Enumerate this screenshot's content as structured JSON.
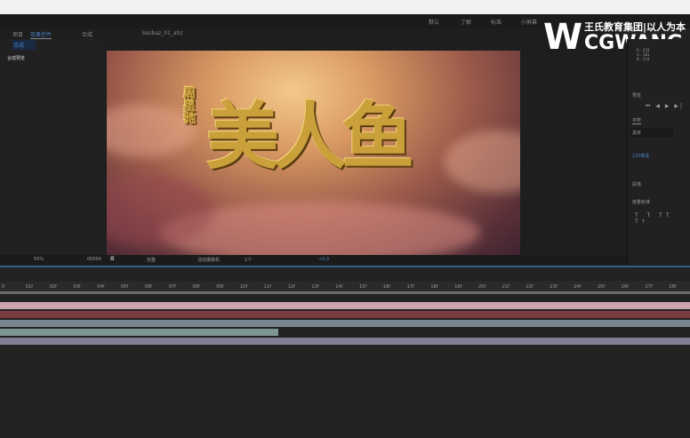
{
  "menubar": {
    "workspaces": [
      "默认",
      "了解",
      "标准",
      "小屏幕"
    ]
  },
  "tabs": {
    "project": "项目",
    "effects": "效果控件",
    "comp": "合成",
    "file": "bazbaz_01_ahz"
  },
  "project": {
    "item": "合成",
    "label": "合成预览"
  },
  "viewer": {
    "title": "美人鱼",
    "subtitle": "周星驰",
    "zoom": "50%",
    "timecode": "00000",
    "quality": "完整",
    "camera": "活动摄像机",
    "view": "1个",
    "offset": "+0.0"
  },
  "right_panel": {
    "info": [
      "R : 233",
      "G : 181",
      "B : 124",
      "A : 255"
    ],
    "preview": "预览",
    "character": "字符",
    "font": "黑体",
    "paragraph": "段落",
    "font_size": "120像素",
    "tracking": "度量标准"
  },
  "timeline": {
    "ticks": [
      "0",
      "01f",
      "02f",
      "03f",
      "04f",
      "05f",
      "06f",
      "07f",
      "08f",
      "09f",
      "10f",
      "11f",
      "12f",
      "13f",
      "14f",
      "15f",
      "16f",
      "17f",
      "18f",
      "19f",
      "20f",
      "21f",
      "22f",
      "23f",
      "24f",
      "25f",
      "26f",
      "27f",
      "28f"
    ],
    "tracks": [
      {
        "color": "#cfa3ad",
        "end": 1
      },
      {
        "color": "#7a3b3f",
        "end": 1
      },
      {
        "color": "#7a8792",
        "end": 1
      },
      {
        "color": "#7f9591",
        "end": 0.403
      },
      {
        "color": "#807f93",
        "end": 1
      }
    ]
  },
  "watermark": {
    "line1": "王氏教育集团|以人为本",
    "line2": "CGWANG"
  }
}
